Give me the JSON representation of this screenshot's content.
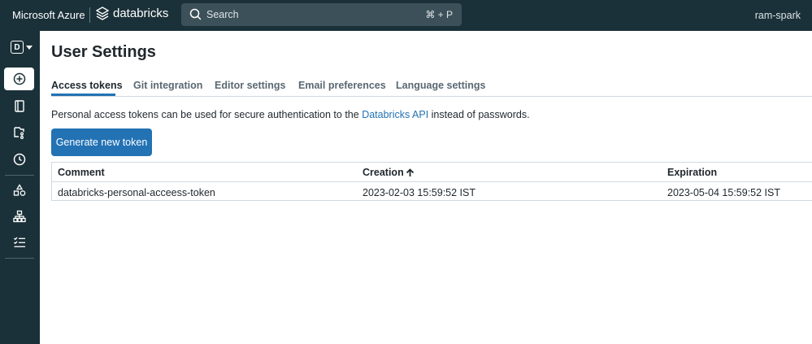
{
  "topbar": {
    "microsoft_label": "Microsoft Azure",
    "databricks_label": "databricks",
    "search_placeholder": "Search",
    "search_shortcut": "⌘ + P",
    "user_name": "ram-spark"
  },
  "sidebar": {
    "persona_letter": "D",
    "items": [
      {
        "name": "new",
        "icon": "plus-circle-icon"
      },
      {
        "name": "workspace",
        "icon": "notebook-icon"
      },
      {
        "name": "repos",
        "icon": "repo-icon"
      },
      {
        "name": "recents",
        "icon": "clock-icon"
      },
      {
        "name": "data",
        "icon": "shapes-icon"
      },
      {
        "name": "compute",
        "icon": "cluster-icon"
      },
      {
        "name": "workflows",
        "icon": "checklist-icon"
      }
    ]
  },
  "page": {
    "title": "User Settings",
    "tabs": [
      {
        "label": "Access tokens",
        "active": true
      },
      {
        "label": "Git integration",
        "active": false
      },
      {
        "label": "Editor settings",
        "active": false
      },
      {
        "label": "Email preferences",
        "active": false
      },
      {
        "label": "Language settings",
        "active": false
      }
    ],
    "description": {
      "before": "Personal access tokens can be used for secure authentication to the ",
      "link": "Databricks API",
      "after": " instead of passwords."
    },
    "generate_button": "Generate new token"
  },
  "table": {
    "headers": [
      "Comment",
      "Creation",
      "Expiration"
    ],
    "sort_icon": "arrow-up-icon",
    "rows": [
      [
        "databricks-personal-acceess-token",
        "2023-02-03 15:59:52 IST",
        "2023-05-04 15:59:52 IST"
      ]
    ]
  },
  "colors": {
    "nav_bg": "#1b3139",
    "accent": "#2272b4"
  }
}
